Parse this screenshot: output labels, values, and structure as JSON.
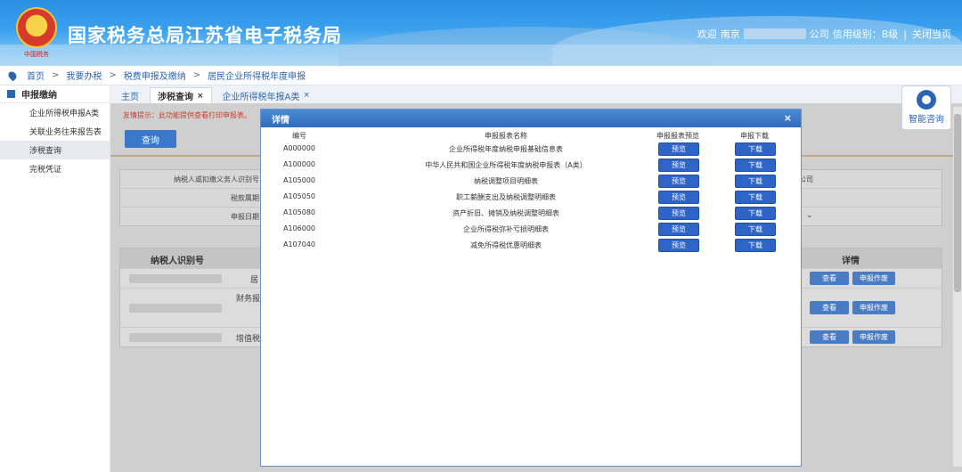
{
  "header": {
    "title": "国家税务总局江苏省电子税务局",
    "emblem_sub": "中国税务",
    "welcome": "欢迎",
    "user_prefix": "南京",
    "user_suffix": "公司",
    "credit": "信用级别：B级",
    "close": "关闭当页"
  },
  "breadcrumb": [
    "首页",
    "我要办税",
    "税费申报及缴纳",
    "居民企业所得税年度申报"
  ],
  "sidebar": {
    "title": "申报缴纳",
    "items": [
      {
        "label": "企业所得税申报A类",
        "active": false
      },
      {
        "label": "关联业务往来报告表",
        "active": false
      },
      {
        "label": "涉税查询",
        "active": true
      },
      {
        "label": "完税凭证",
        "active": false
      }
    ]
  },
  "tabs": [
    {
      "label": "主页",
      "closable": false,
      "active": false
    },
    {
      "label": "涉税查询",
      "closable": true,
      "active": true
    },
    {
      "label": "企业所得税年报A类",
      "closable": true,
      "active": false
    }
  ],
  "content": {
    "tip": "友情提示：此功能提供查看打印申报表。",
    "query_button": "查询",
    "form": {
      "taxpayer_id_label": "纳税人或扣缴义务人识别号",
      "period_label": "税款属期",
      "date_label": "申报日期",
      "right_value": "公司"
    },
    "table": {
      "col_taxpayer_id": "纳税人识别号",
      "col_detail": "详情",
      "rows": [
        {
          "col2": "居",
          "view": "查看",
          "void": "申报作废"
        },
        {
          "col2": "财务报",
          "view": "查看",
          "void": "申报作废"
        },
        {
          "col2": "增值税",
          "view": "查看",
          "void": "申报作废"
        }
      ]
    }
  },
  "consult": {
    "label": "智能咨询"
  },
  "modal": {
    "title": "详情",
    "close": "×",
    "headers": {
      "code": "编号",
      "name": "申报报表名称",
      "preview": "申报报表预览",
      "download": "申报下载"
    },
    "rows": [
      {
        "code": "A000000",
        "name": "企业所得税年度纳税申报基础信息表",
        "preview": "预览",
        "download": "下载"
      },
      {
        "code": "A100000",
        "name": "中华人民共和国企业所得税年度纳税申报表（A类）",
        "preview": "预览",
        "download": "下载"
      },
      {
        "code": "A105000",
        "name": "纳税调整项目明细表",
        "preview": "预览",
        "download": "下载"
      },
      {
        "code": "A105050",
        "name": "职工薪酬支出及纳税调整明细表",
        "preview": "预览",
        "download": "下载"
      },
      {
        "code": "A105080",
        "name": "资产折旧、摊销及纳税调整明细表",
        "preview": "预览",
        "download": "下载"
      },
      {
        "code": "A106000",
        "name": "企业所得税弥补亏损明细表",
        "preview": "预览",
        "download": "下载"
      },
      {
        "code": "A107040",
        "name": "减免所得税优惠明细表",
        "preview": "预览",
        "download": "下载"
      }
    ]
  },
  "colors": {
    "brand_blue": "#2a66b3",
    "button_blue": "#2e64c6",
    "tip_red": "#d23a2a"
  }
}
